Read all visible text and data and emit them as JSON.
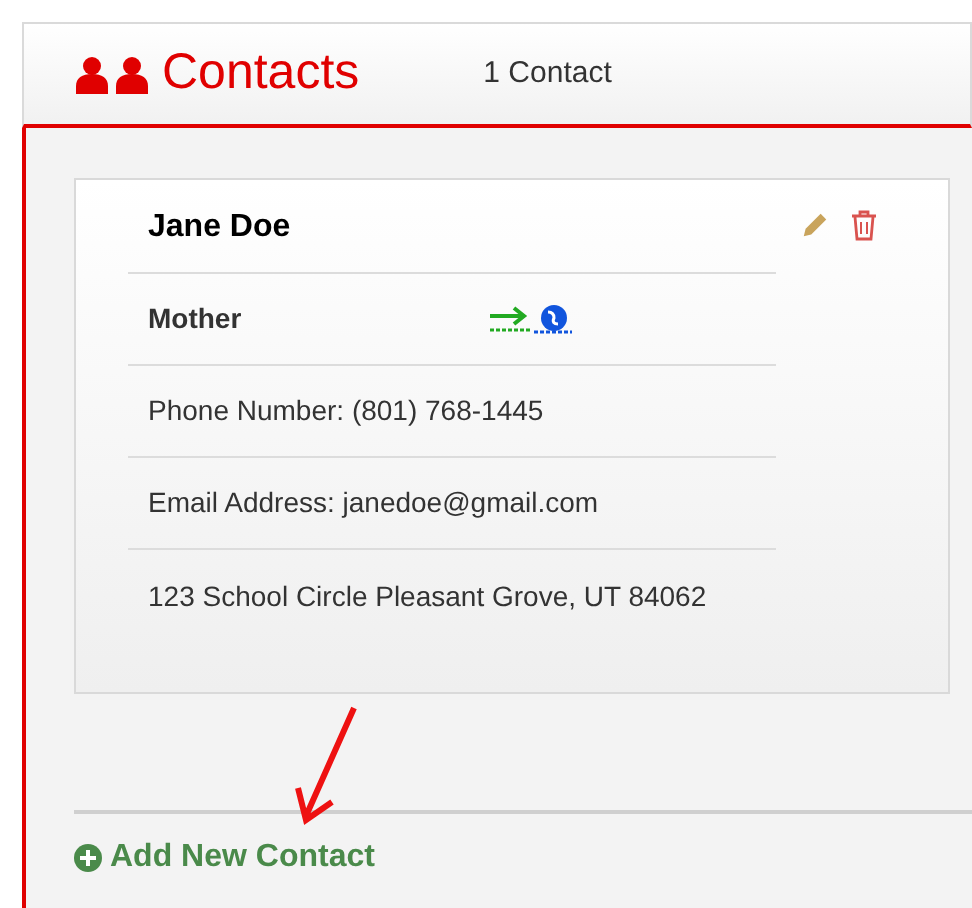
{
  "header": {
    "title": "Contacts",
    "count": "1 Contact"
  },
  "contacts": [
    {
      "name": "Jane Doe",
      "relationship": "Mother",
      "phone": "Phone Number: (801) 768-1445",
      "email": "Email Address: janedoe@gmail.com",
      "address": "123 School Circle Pleasant Grove, UT 84062"
    }
  ],
  "add_button": "Add New Contact"
}
